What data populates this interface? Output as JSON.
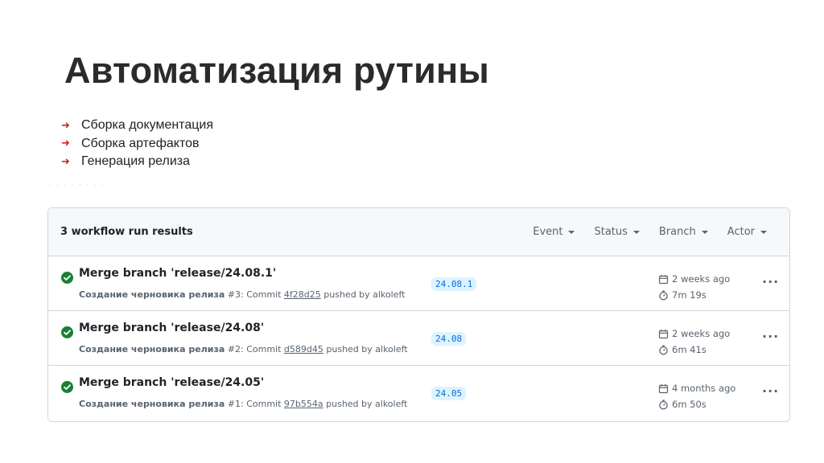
{
  "slide": {
    "title": "Автоматизация рутины",
    "bullets": [
      "Сборка документация",
      "Сборка артефактов",
      "Генерация релиза"
    ],
    "bullet_arrow": "➜",
    "faint_text": "· · · · · · · ·"
  },
  "workflow_panel": {
    "results_label": "3 workflow run results",
    "filters": [
      "Event",
      "Status",
      "Branch",
      "Actor"
    ],
    "runs": [
      {
        "title": "Merge branch 'release/24.08.1'",
        "workflow": "Создание черновика релиза",
        "run_number": "#3",
        "commit_prefix": ": Commit ",
        "sha": "4f28d25",
        "pushed_by": " pushed by alkoleft",
        "branch": "24.08.1",
        "when": "2 weeks ago",
        "duration": "7m 19s",
        "status": "success"
      },
      {
        "title": "Merge branch 'release/24.08'",
        "workflow": "Создание черновика релиза",
        "run_number": "#2",
        "commit_prefix": ": Commit ",
        "sha": "d589d45",
        "pushed_by": " pushed by alkoleft",
        "branch": "24.08",
        "when": "2 weeks ago",
        "duration": "6m 41s",
        "status": "success"
      },
      {
        "title": "Merge branch 'release/24.05'",
        "workflow": "Создание черновика релиза",
        "run_number": "#1",
        "commit_prefix": ": Commit ",
        "sha": "97b554a",
        "pushed_by": " pushed by alkoleft",
        "branch": "24.05",
        "when": "4 months ago",
        "duration": "6m 50s",
        "status": "success"
      }
    ],
    "more_label": "···"
  },
  "colors": {
    "success": "#1a7f37",
    "bullet_arrow": "#d1242f",
    "branch_bg": "#ddf4ff",
    "branch_fg": "#0969da"
  },
  "icons": [
    "check-circle-icon",
    "calendar-icon",
    "stopwatch-icon",
    "kebab-menu-icon",
    "caret-down-icon"
  ]
}
